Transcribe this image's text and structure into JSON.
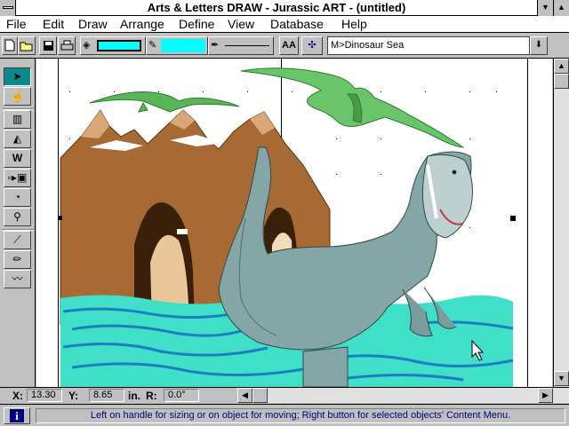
{
  "window": {
    "title": "Arts & Letters DRAW - Jurassic ART - (untitled)"
  },
  "menu": {
    "items": [
      "File",
      "Edit",
      "Draw",
      "Arrange",
      "Define",
      "View",
      "Database",
      "Help"
    ]
  },
  "toolbar": {
    "style_field": "M>Dinosaur Sea",
    "text_button": "AA"
  },
  "coords": {
    "x_label": "X:",
    "x_value": "13.30",
    "y_label": "Y:",
    "y_value": "8.65",
    "unit": "in.",
    "r_label": "R:",
    "r_value": "0.0°"
  },
  "status": {
    "message": "Left on handle for sizing or on object for moving; Right button for selected objects' Content Menu."
  },
  "colors": {
    "fill_swatch": "#00ffff",
    "sea": "#40e0c8",
    "dinosaur": "#7fa4a4",
    "pterosaur": "#5ab45a",
    "cliffs": "#a0642c",
    "accent": "#000080"
  },
  "icons": [
    "new-file-icon",
    "open-folder-icon",
    "save-icon",
    "print-icon",
    "paint-can-icon",
    "pen-icon",
    "pointer-icon",
    "hand-icon",
    "chart-icon",
    "shapes-icon",
    "text-icon",
    "symbol-icon",
    "rotate-icon",
    "zoom-icon",
    "line-icon",
    "pencil-icon",
    "freehand-icon",
    "info-icon"
  ]
}
